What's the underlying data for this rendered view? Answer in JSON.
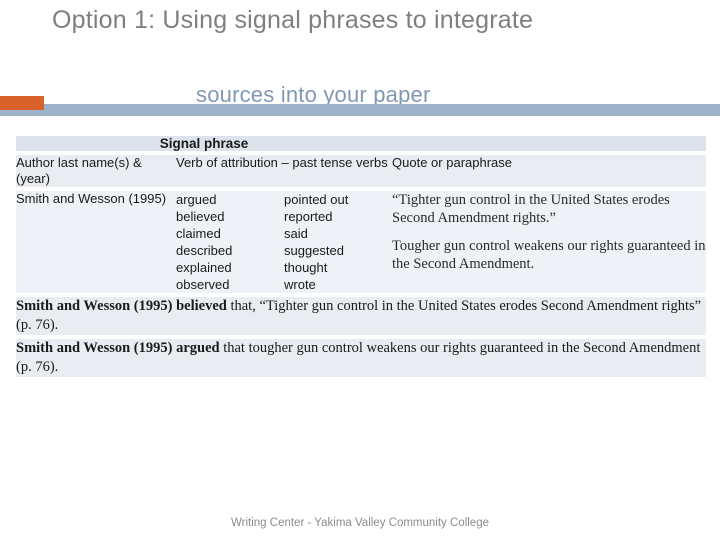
{
  "slide": {
    "title_line1": "Option 1: Using signal phrases to integrate",
    "title_line2": "sources into your paper",
    "accent_color": "#d9622b",
    "band_color": "#9fb2cb"
  },
  "table": {
    "header": {
      "signal_phrase": "Signal phrase",
      "right_blank": ""
    },
    "column_headings": {
      "author": "Author last name(s) & (year)",
      "verbs": "Verb of attribution – past tense verbs",
      "quote": "Quote or paraphrase"
    },
    "row": {
      "author": "Smith and Wesson (1995)",
      "verbs_col1": [
        "argued",
        "believed",
        "claimed",
        "described",
        "explained",
        "observed"
      ],
      "verbs_col2": [
        "pointed out",
        "reported",
        "said",
        "suggested",
        "thought",
        "wrote"
      ],
      "quote_1": "“Tighter gun control in the United States erodes Second Amendment rights.”",
      "quote_2": "Tougher gun control weakens our rights guaranteed in the Second Amendment."
    },
    "examples": [
      {
        "bold": "Smith and Wesson (1995) believed",
        "rest": " that, “Tighter gun control in the United States erodes Second Amendment rights” (p. 76)."
      },
      {
        "bold": "Smith and Wesson (1995) argued",
        "rest": " that tougher gun control weakens our rights guaranteed in the Second Amendment (p. 76)."
      }
    ]
  },
  "footer": {
    "text": "Writing Center - Yakima Valley Community College"
  }
}
